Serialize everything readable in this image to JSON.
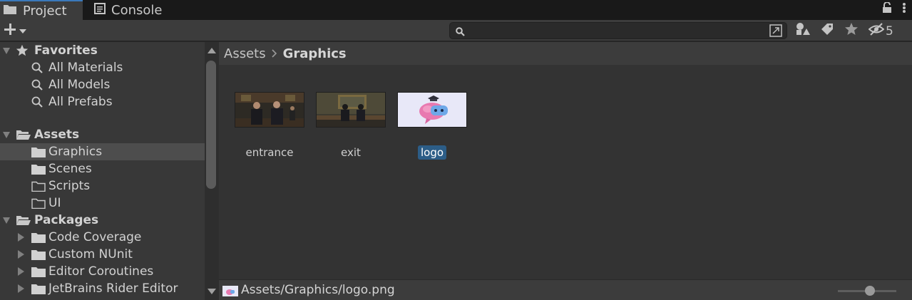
{
  "tabs": [
    {
      "label": "Project",
      "icon": "folder-icon",
      "active": true
    },
    {
      "label": "Console",
      "icon": "console-icon",
      "active": false
    }
  ],
  "toolbar": {
    "create_icon": "plus-icon",
    "search_placeholder": "",
    "hidden_count": "5"
  },
  "tree": {
    "favorites": {
      "label": "Favorites",
      "items": [
        "All Materials",
        "All Models",
        "All Prefabs"
      ]
    },
    "assets": {
      "label": "Assets",
      "items": [
        "Graphics",
        "Scenes",
        "Scripts",
        "UI"
      ]
    },
    "packages": {
      "label": "Packages",
      "items": [
        "Code Coverage",
        "Custom NUnit",
        "Editor Coroutines",
        "JetBrains Rider Editor"
      ]
    }
  },
  "breadcrumb": {
    "root": "Assets",
    "current": "Graphics"
  },
  "assets": [
    {
      "name": "entrance",
      "selected": false
    },
    {
      "name": "exit",
      "selected": false
    },
    {
      "name": "logo",
      "selected": true
    }
  ],
  "status": {
    "path": "Assets/Graphics/logo.png"
  },
  "colors": {
    "accent": "#3a79bb",
    "selection": "#2c5d87",
    "panel": "#383838"
  }
}
